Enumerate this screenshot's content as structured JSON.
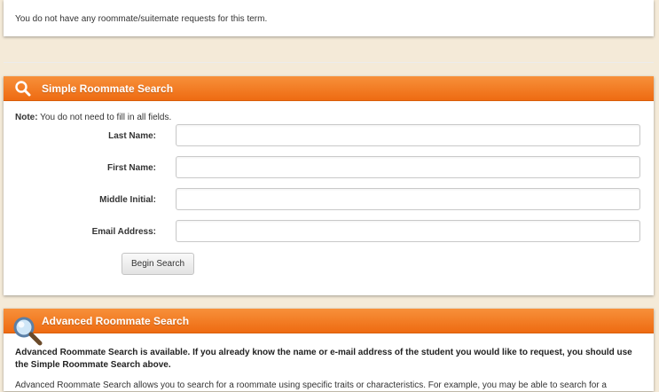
{
  "notice": {
    "text": "You do not have any roommate/suitemate requests for this term."
  },
  "simple_search": {
    "title": "Simple Roommate Search",
    "note_label": "Note:",
    "note_text": " You do not need to fill in all fields.",
    "fields": [
      {
        "label": "Last Name:",
        "value": "",
        "placeholder": ""
      },
      {
        "label": "First Name:",
        "value": "",
        "placeholder": ""
      },
      {
        "label": "Middle Initial:",
        "value": "",
        "placeholder": ""
      },
      {
        "label": "Email Address:",
        "value": "",
        "placeholder": ""
      }
    ],
    "button_label": "Begin Search"
  },
  "advanced_search": {
    "title": "Advanced Roommate Search",
    "bold_text": "Advanced Roommate Search is available. If you already know the name or e-mail address of the student you would like to request, you should use the Simple Roommate Search above.",
    "body_text": "Advanced Roommate Search allows you to search for a roommate using specific traits or characteristics. For example, you may be able to search for a"
  },
  "colors": {
    "header_orange": "#ee6b12",
    "page_background": "#f4ead8"
  },
  "icons": [
    "search-icon",
    "magnifier-icon"
  ]
}
